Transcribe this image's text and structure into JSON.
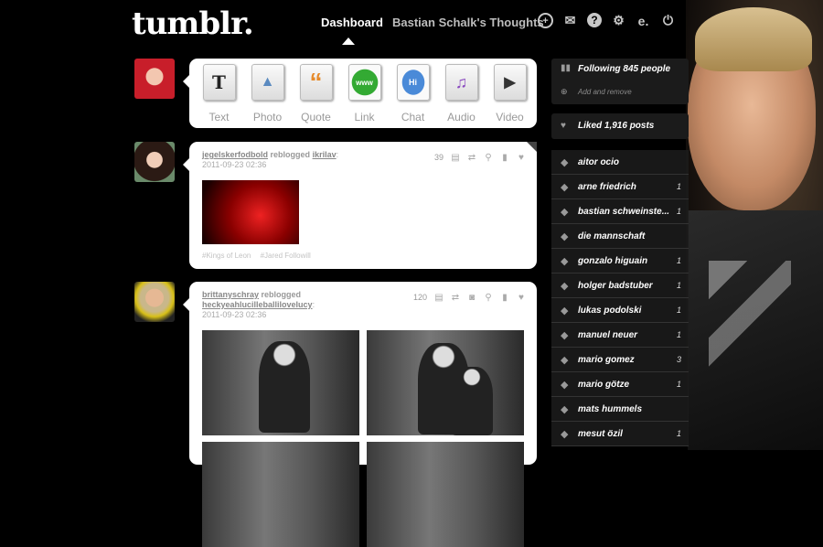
{
  "header": {
    "logo": "tumblr.",
    "nav_dashboard": "Dashboard",
    "nav_blog": "Bastian Schalk's Thoughts",
    "icons": [
      "plus-circle-icon",
      "mail-icon",
      "help-icon",
      "gear-icon",
      "e-icon",
      "power-icon"
    ],
    "icon_glyphs": [
      "+",
      "✉",
      "?",
      "⚙",
      "e.",
      "⏻"
    ]
  },
  "compose": {
    "items": [
      {
        "label": "Text",
        "glyph": "T"
      },
      {
        "label": "Photo",
        "glyph": "▲"
      },
      {
        "label": "Quote",
        "glyph": "“"
      },
      {
        "label": "Link",
        "glyph": "www"
      },
      {
        "label": "Chat",
        "glyph": "Hi"
      },
      {
        "label": "Audio",
        "glyph": "♫"
      },
      {
        "label": "Video",
        "glyph": "▶"
      }
    ]
  },
  "posts": [
    {
      "user": "jegelskerfodbold",
      "verb": "reblogged",
      "source": "ikrilav",
      "date": "2011-09-23 02:36",
      "notes": "39",
      "tags": [
        "#Kings of Leon",
        "#Jared Followill"
      ]
    },
    {
      "user": "brittanyschray",
      "verb": "reblogged",
      "source": "heckyeahlucilleballilovelucy",
      "date": "2011-09-23 02:36",
      "notes": "120"
    }
  ],
  "sidebar": {
    "following": "Following 845 people",
    "add_remove": "Add and remove",
    "liked": "Liked 1,916 posts",
    "tags": [
      {
        "name": "aitor ocio",
        "count": ""
      },
      {
        "name": "arne friedrich",
        "count": "1"
      },
      {
        "name": "bastian schweinste...",
        "count": "1"
      },
      {
        "name": "die mannschaft",
        "count": ""
      },
      {
        "name": "gonzalo higuain",
        "count": "1"
      },
      {
        "name": "holger badstuber",
        "count": "1"
      },
      {
        "name": "lukas podolski",
        "count": "1"
      },
      {
        "name": "manuel neuer",
        "count": "1"
      },
      {
        "name": "mario gomez",
        "count": "3"
      },
      {
        "name": "mario götze",
        "count": "1"
      },
      {
        "name": "mats hummels",
        "count": ""
      },
      {
        "name": "mesut özil",
        "count": "1"
      }
    ]
  }
}
